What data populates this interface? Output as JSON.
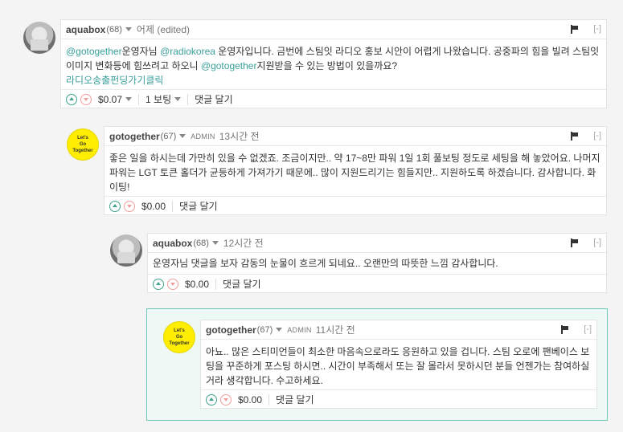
{
  "comments": [
    {
      "author": "aquabox",
      "rep": "(68)",
      "admin": "",
      "time": "어제 (edited)",
      "collapse": "[-]",
      "body_parts": {
        "m1": "@gotogether",
        "t1": "운영자님 ",
        "m2": "@radiokorea",
        "t2": " 운영자입니다. 금번에 스팀잇 라디오 홍보 시안이 어렵게 나왔습니다. 공중파의 힘을 빌려 스팀잇 이미지 변화등에 힘쓰려고 하오니 ",
        "m3": "@gotogether",
        "t3": "지원받을 수 있는 방법이 있을까요?",
        "link": "라디오송출펀딩가기클릭"
      },
      "payout": "$0.07",
      "votes": "1 보팅",
      "reply": "댓글 달기"
    },
    {
      "author": "gotogether",
      "rep": "(67)",
      "admin": "ADMIN",
      "time": "13시간 전",
      "collapse": "[-]",
      "body": "좋은 일을 하시는데 가만히 있을 수 없겠죠. 조금이지만.. 약 17~8만 파워 1일 1회 풀보팅 정도로 세팅을 해 놓았어요. 나머지 파워는 LGT 토큰 홀더가 균등하게 가져가기 때문에.. 많이 지원드리기는 힘들지만.. 지원하도록 하겠습니다. 감사합니다. 화이팅!",
      "payout": "$0.00",
      "reply": "댓글 달기"
    },
    {
      "author": "aquabox",
      "rep": "(68)",
      "admin": "",
      "time": "12시간 전",
      "collapse": "[-]",
      "body": "운영자님 댓글을 보자 감동의 눈물이 흐르게 되네요.. 오랜만의 따뜻한 느낌 감사합니다.",
      "payout": "$0.00",
      "reply": "댓글 달기"
    },
    {
      "author": "gotogether",
      "rep": "(67)",
      "admin": "ADMIN",
      "time": "11시간 전",
      "collapse": "[-]",
      "body": "아뇨.. 많은 스티미언들이 최소한 마음속으로라도 응원하고 있을 겁니다. 스팀 오로에 팬베이스 보팅을 꾸준하게 포스팅 하시면.. 시간이 부족해서 또는 잘 몰라서 못하시던 분들 언젠가는 참여하실거라 생각합니다. 수고하세요.",
      "payout": "$0.00",
      "reply": "댓글 달기"
    }
  ],
  "logo_text": [
    "Let's",
    "Go",
    "Together"
  ],
  "colors": {
    "accent": "#3a9f9b",
    "highlight_border": "#70c9b6",
    "logo_yellow": "#ffee00"
  }
}
